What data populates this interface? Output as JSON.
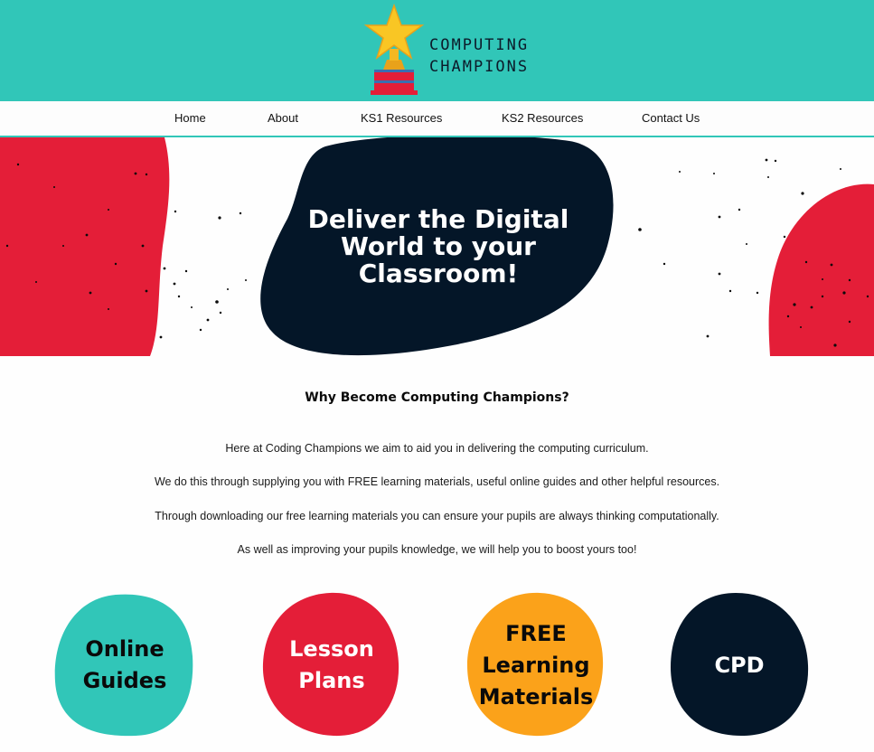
{
  "colors": {
    "teal": "#31c6b8",
    "red": "#e41e38",
    "navy": "#041628",
    "orange": "#fba21a",
    "white": "#ffffff"
  },
  "logo": {
    "line1": "COMPUTING",
    "line2": "CHAMPIONS",
    "icon": "trophy-star-icon"
  },
  "nav": {
    "items": [
      "Home",
      "About",
      "KS1 Resources",
      "KS2 Resources",
      "Contact Us"
    ]
  },
  "hero": {
    "title_line1": "Deliver the Digital",
    "title_line2": "World to your",
    "title_line3": "Classroom!"
  },
  "intro": {
    "heading": "Why Become Computing Champions?",
    "paragraphs": [
      "Here at Coding Champions we aim to aid you in delivering the computing curriculum.",
      "We do this through supplying you with FREE learning materials, useful online guides and other helpful resources.",
      "Through downloading our free learning materials you can ensure your pupils are always thinking computationally.",
      "As well as improving your pupils knowledge, we will help you to boost yours too!"
    ]
  },
  "cards": [
    {
      "line1": "Online",
      "line2": "Guides",
      "line3": "",
      "color": "#31c6b8",
      "text_color": "#0a0a0a"
    },
    {
      "line1": "Lesson",
      "line2": "Plans",
      "line3": "",
      "color": "#e41e38",
      "text_color": "#ffffff"
    },
    {
      "line1": "FREE",
      "line2": "Learning",
      "line3": "Materials",
      "color": "#fba21a",
      "text_color": "#0a0a0a"
    },
    {
      "line1": "CPD",
      "line2": "",
      "line3": "",
      "color": "#041628",
      "text_color": "#ffffff"
    }
  ]
}
